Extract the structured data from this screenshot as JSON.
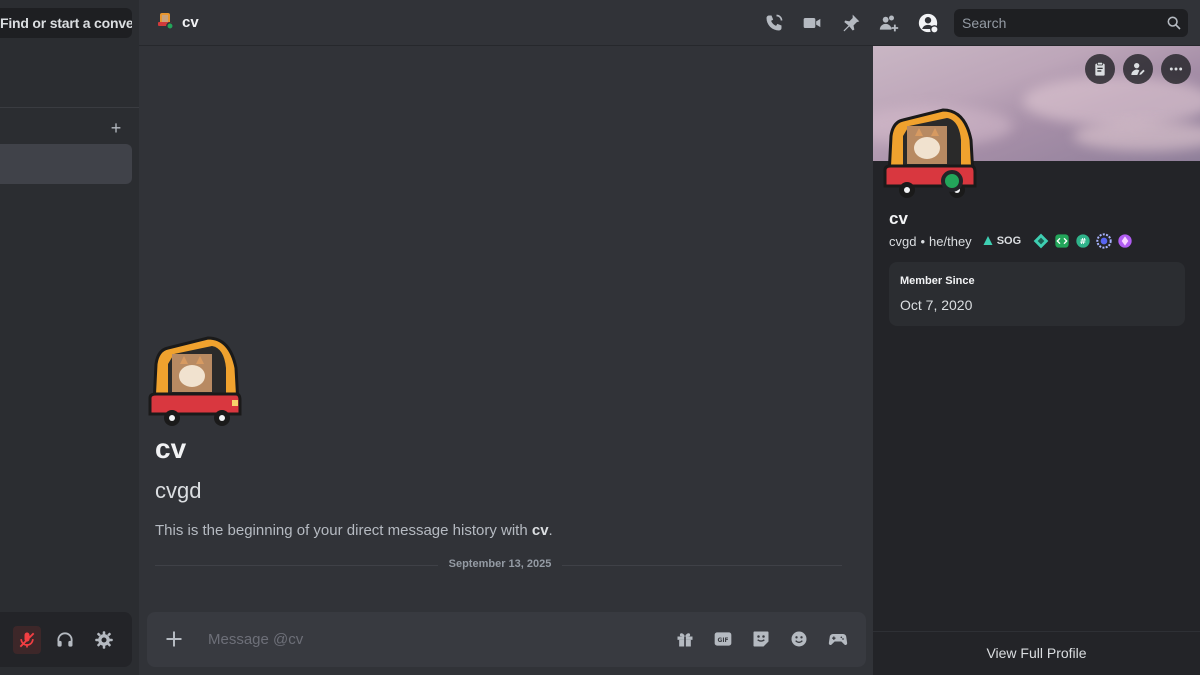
{
  "sidebar": {
    "find_label": "Find or start a conversation",
    "add_dm_label": "+"
  },
  "topbar": {
    "channel_name": "cv",
    "search_placeholder": "Search",
    "icons": [
      "voice-call-icon",
      "video-call-icon",
      "pin-icon",
      "add-friends-icon",
      "user-profile-icon"
    ]
  },
  "chat": {
    "name": "cv",
    "username": "cvgd",
    "intro_prefix": "This is the beginning of your direct message history with ",
    "intro_name": "cv",
    "intro_suffix": ".",
    "date_divider": "September 13, 2025",
    "composer_placeholder": "Message @cv",
    "composer_icons": [
      "gift-icon",
      "gif-icon",
      "sticker-icon",
      "emoji-icon",
      "activity-icon"
    ]
  },
  "profile": {
    "name": "cv",
    "username": "cvgd",
    "separator": "•",
    "pronouns": "he/they",
    "guild_tag": "SOG",
    "member_since_label": "Member Since",
    "member_since_date": "Oct 7, 2020",
    "view_full_profile": "View Full Profile",
    "status": "online"
  },
  "colors": {
    "accent_online": "#23a55a",
    "background": "#313338",
    "sidebar": "#2b2d31",
    "panel": "#232428"
  }
}
